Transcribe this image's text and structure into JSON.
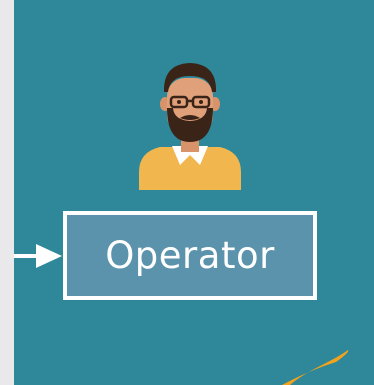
{
  "node": {
    "label": "Operator",
    "icon": "operator-avatar-icon"
  },
  "colors": {
    "panel_background": "#2f8899",
    "box_fill": "#5a93ab",
    "box_border": "#ffffff",
    "arrow": "#ffffff",
    "sweater": "#f2b64e",
    "accent_shape": "#f2a31b"
  }
}
